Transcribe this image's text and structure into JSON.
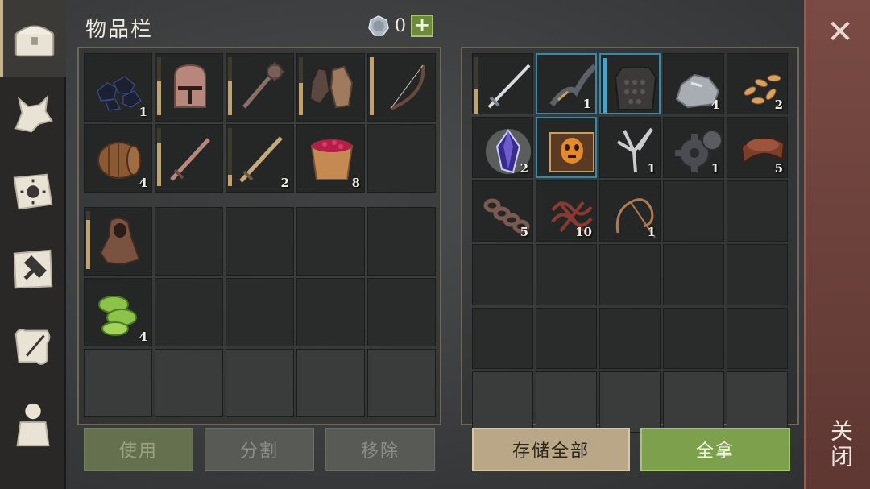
{
  "header": {
    "title": "物品栏",
    "coin_count": "0",
    "add_symbol": "+"
  },
  "sidebar": {
    "tabs": [
      {
        "icon": "chest-icon",
        "active": true
      },
      {
        "icon": "wolf-icon",
        "active": false
      },
      {
        "icon": "sun-book-icon",
        "active": false
      },
      {
        "icon": "hammer-icon",
        "active": false
      },
      {
        "icon": "quill-scroll-icon",
        "active": false
      },
      {
        "icon": "character-icon",
        "active": false
      }
    ]
  },
  "inventory": {
    "quick_slots": [
      {
        "item": "coal",
        "count": "1"
      },
      {
        "item": "iron-helmet",
        "durability": 0.6
      },
      {
        "item": "mace",
        "durability": 0.6
      },
      {
        "item": "leather-gloves",
        "durability": 0.55
      },
      {
        "item": "bow",
        "durability": 1.0
      },
      {
        "item": "barrel",
        "count": "4"
      },
      {
        "item": "sword",
        "durability": 0.75
      },
      {
        "item": "long-sword",
        "durability": 0.2,
        "count": "2"
      },
      {
        "item": "berry-bucket",
        "count": "8"
      },
      {
        "item": ""
      }
    ],
    "bag_slots": [
      {
        "item": "hooded-cloak",
        "durability": 0.85
      },
      {
        "item": ""
      },
      {
        "item": ""
      },
      {
        "item": ""
      },
      {
        "item": ""
      },
      {
        "item": "cactus-food",
        "count": "4"
      },
      {
        "item": ""
      },
      {
        "item": ""
      },
      {
        "item": ""
      },
      {
        "item": ""
      },
      {
        "item": "",
        "faint": true
      },
      {
        "item": "",
        "faint": true
      },
      {
        "item": "",
        "faint": true
      },
      {
        "item": "",
        "faint": true
      },
      {
        "item": "",
        "faint": true
      }
    ],
    "buttons": {
      "use": "使用",
      "split": "分割",
      "remove": "移除"
    }
  },
  "storage": {
    "slots": [
      {
        "item": "steel-sword",
        "durability": 0.45
      },
      {
        "item": "recurve-bow",
        "count": "1",
        "selected": true
      },
      {
        "item": "chain-armor",
        "durability": 1.0,
        "blue": true,
        "selected": true
      },
      {
        "item": "stone",
        "count": "4"
      },
      {
        "item": "seeds",
        "count": "2"
      },
      {
        "item": "crystal",
        "count": "2"
      },
      {
        "item": "mask-book",
        "selected": true
      },
      {
        "item": "claw",
        "count": "1"
      },
      {
        "item": "gear",
        "count": "1"
      },
      {
        "item": "leather",
        "count": "5"
      },
      {
        "item": "chain",
        "count": "5"
      },
      {
        "item": "rope-bundle",
        "count": "10"
      },
      {
        "item": "rope",
        "count": "1"
      },
      {
        "item": ""
      },
      {
        "item": ""
      },
      {
        "item": ""
      },
      {
        "item": ""
      },
      {
        "item": ""
      },
      {
        "item": ""
      },
      {
        "item": ""
      },
      {
        "item": ""
      },
      {
        "item": ""
      },
      {
        "item": ""
      },
      {
        "item": ""
      },
      {
        "item": ""
      },
      {
        "item": "",
        "faint": true
      },
      {
        "item": "",
        "faint": true
      },
      {
        "item": "",
        "faint": true
      },
      {
        "item": "",
        "faint": true
      },
      {
        "item": "",
        "faint": true
      }
    ],
    "buttons": {
      "store_all": "存储全部",
      "take_all": "全拿"
    }
  },
  "close": {
    "label": "关闭",
    "symbol": "✕"
  }
}
